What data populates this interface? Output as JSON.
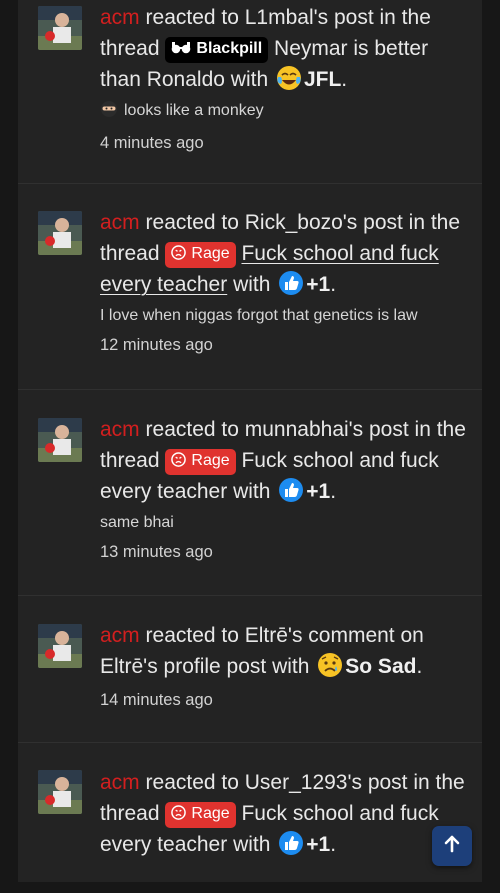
{
  "colors": {
    "background": "#171717",
    "panel": "#232323",
    "username": "#d21f1f",
    "rage_prefix": "#e0332f",
    "blackpill_prefix": "#000000",
    "scroll_button": "#1d3f7a"
  },
  "alerts": [
    {
      "user": "acm",
      "text_before": " reacted to L1mbal's post in the thread ",
      "prefix": {
        "label": "Blackpill",
        "icon": "glasses-icon"
      },
      "thread": " Neymar is better than Ronaldo",
      "text_mid": " with ",
      "reaction_icon": "tears-of-joy-emoji",
      "reaction": "JFL",
      "end": ".",
      "snippet": "looks like a monkey",
      "snippet_icon": "ninja-emoji",
      "time": "4 minutes ago"
    },
    {
      "user": "acm",
      "text_before": " reacted to Rick_bozo's post in the thread ",
      "prefix": {
        "label": "Rage",
        "icon": "angry-face-icon"
      },
      "thread": "Fuck school and fuck every teacher",
      "text_mid": " with ",
      "reaction_icon": "thumbs-up-emoji",
      "reaction": "+1",
      "end": ".",
      "snippet": "I love when niggas forgot that genetics is law",
      "time": "12 minutes ago"
    },
    {
      "user": "acm",
      "text_before": " reacted to munnabhai's post in the thread ",
      "prefix": {
        "label": "Rage",
        "icon": "angry-face-icon"
      },
      "thread": " Fuck school and fuck every teacher",
      "text_mid": " with ",
      "reaction_icon": "thumbs-up-emoji",
      "reaction": "+1",
      "end": ".",
      "snippet": "same bhai",
      "time": "13 minutes ago"
    },
    {
      "user": "acm",
      "text_before": " reacted to Eltrē's comment on Eltrē's profile post with ",
      "reaction_icon": "sad-face-emoji",
      "reaction": "So Sad",
      "end": ".",
      "time": "14 minutes ago"
    },
    {
      "user": "acm",
      "text_before": " reacted to User_1293's post in the thread ",
      "prefix": {
        "label": "Rage",
        "icon": "angry-face-icon"
      },
      "thread": " Fuck school and fuck every teacher",
      "text_mid": " with ",
      "reaction_icon": "thumbs-up-emoji",
      "reaction": "+1",
      "end": "."
    }
  ],
  "scroll_top": {
    "icon": "arrow-up-icon"
  }
}
